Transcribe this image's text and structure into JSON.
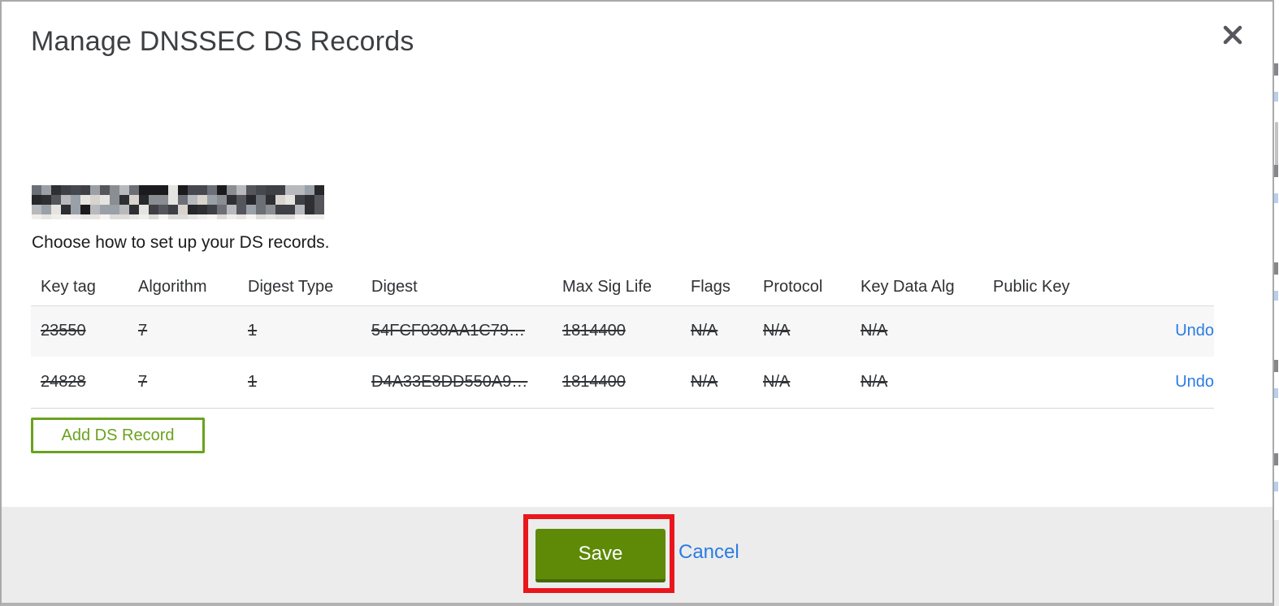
{
  "modal": {
    "title": "Manage DNSSEC DS Records",
    "intro": "Choose how to set up your DS records.",
    "table": {
      "headers": [
        "Key tag",
        "Algorithm",
        "Digest Type",
        "Digest",
        "Max Sig Life",
        "Flags",
        "Protocol",
        "Key Data Alg",
        "Public Key"
      ],
      "rows": [
        {
          "key_tag": "23550",
          "algorithm": "7",
          "digest_type": "1",
          "digest": "54FCF030AA1C79…",
          "max_sig_life": "1814400",
          "flags": "N/A",
          "protocol": "N/A",
          "key_data_alg": "N/A",
          "public_key": "",
          "action": "Undo",
          "state": "pending-delete"
        },
        {
          "key_tag": "24828",
          "algorithm": "7",
          "digest_type": "1",
          "digest": "D4A33E8DD550A9…",
          "max_sig_life": "1814400",
          "flags": "N/A",
          "protocol": "N/A",
          "key_data_alg": "N/A",
          "public_key": "",
          "action": "Undo",
          "state": "pending-delete"
        }
      ]
    },
    "add_button_label": "Add DS Record",
    "footer": {
      "save_label": "Save",
      "cancel_label": "Cancel"
    }
  },
  "icons": {
    "close": "x-close-icon"
  },
  "colors": {
    "accent_green": "#6aa21c",
    "save_green": "#5e8a08",
    "annotation_red": "#e9161c",
    "link_blue": "#2b7ce2",
    "row_alt_gray": "#f7f7f7",
    "footer_gray": "#ececec"
  }
}
